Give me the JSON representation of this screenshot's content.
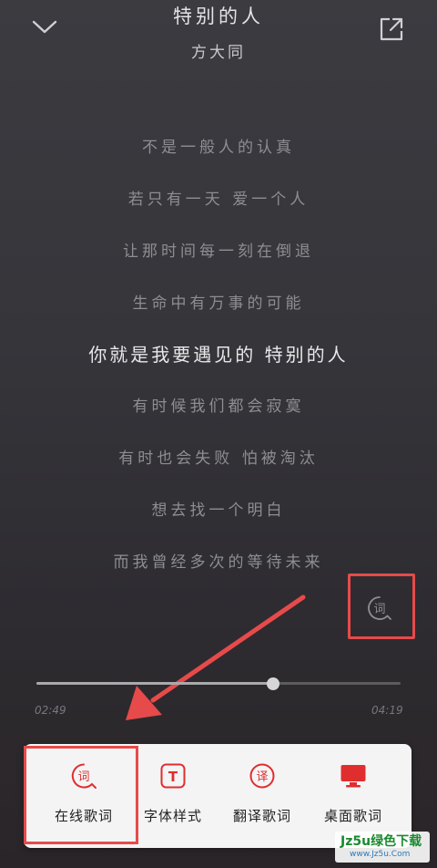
{
  "header": {
    "title": "特别的人",
    "artist": "方大同",
    "back_icon": "chevron-down-icon",
    "share_icon": "share-icon"
  },
  "lyrics": [
    "不是一般人的认真",
    "若只有一天 爱一个人",
    "让那时间每一刻在倒退",
    "生命中有万事的可能",
    "你就是我要遇见的 特别的人",
    "有时候我们都会寂寞",
    "有时也会失败 怕被淘汰",
    "想去找一个明白",
    "而我曾经多次的等待未来"
  ],
  "current_lyric_index": 4,
  "lyric_toggle": {
    "glyph": "词"
  },
  "player": {
    "elapsed": "02:49",
    "total": "04:19",
    "progress": 0.65
  },
  "lyric_menu": {
    "items": [
      {
        "label": "在线歌词",
        "glyph": "词",
        "icon": "online-lyrics-icon"
      },
      {
        "label": "字体样式",
        "glyph": "T",
        "icon": "font-style-icon"
      },
      {
        "label": "翻译歌词",
        "glyph": "译",
        "icon": "translate-lyrics-icon"
      },
      {
        "label": "桌面歌词",
        "glyph": "",
        "icon": "desktop-lyrics-icon"
      }
    ]
  },
  "watermark": {
    "main": "Jz5u绿色下载",
    "sub": "www.Jz5u.Com"
  },
  "colors": {
    "accent": "#e02e2e",
    "highlight": "#e74a4a"
  }
}
